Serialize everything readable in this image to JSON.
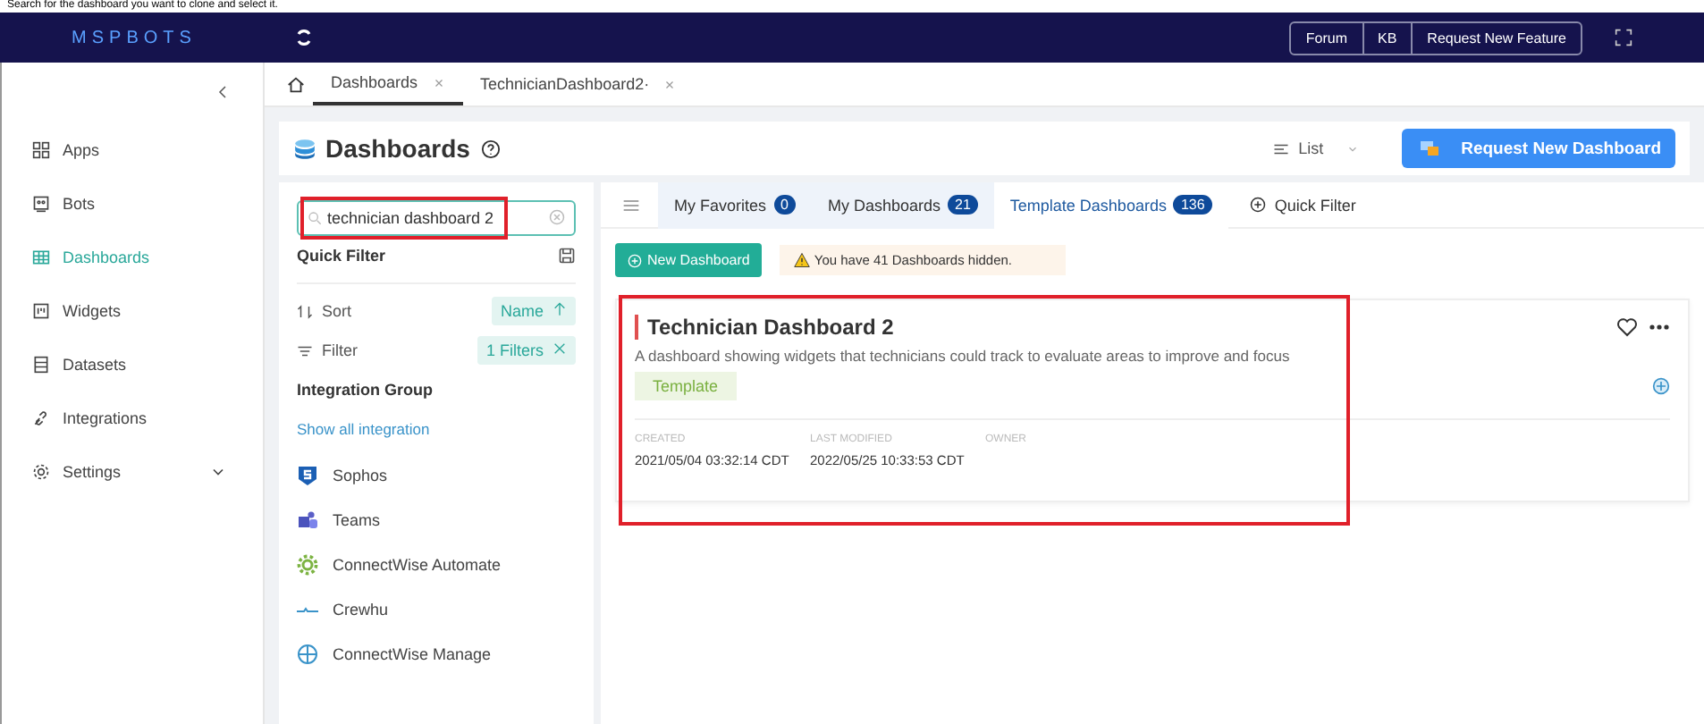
{
  "caption": "Search for the dashboard you want to clone and select it.",
  "topbar": {
    "logo": "MSPBOTS",
    "links": [
      "Forum",
      "KB",
      "Request New Feature"
    ]
  },
  "sidebar": {
    "items": [
      {
        "label": "Apps",
        "selected": false
      },
      {
        "label": "Bots",
        "selected": false
      },
      {
        "label": "Dashboards",
        "selected": true
      },
      {
        "label": "Widgets",
        "selected": false
      },
      {
        "label": "Datasets",
        "selected": false
      },
      {
        "label": "Integrations",
        "selected": false
      },
      {
        "label": "Settings",
        "selected": false,
        "expandable": true
      }
    ]
  },
  "page_tabs": [
    {
      "label": "Dashboards",
      "selected": true
    },
    {
      "label": "TechnicianDashboard2·",
      "selected": false
    }
  ],
  "header": {
    "title": "Dashboards",
    "view": "List",
    "action": "Request New Dashboard"
  },
  "filter_panel": {
    "search": {
      "value": "technician dashboard 2",
      "highlighted": true
    },
    "quick_filter": "Quick Filter",
    "sort": {
      "label": "Sort",
      "value": "Name"
    },
    "filter": {
      "label": "Filter",
      "value": "1 Filters"
    },
    "group_title": "Integration Group",
    "show_all": "Show all integration",
    "integrations": [
      {
        "name": "Sophos"
      },
      {
        "name": "Teams"
      },
      {
        "name": "ConnectWise Automate"
      },
      {
        "name": "Crewhu"
      },
      {
        "name": "ConnectWise Manage"
      }
    ]
  },
  "tabs": [
    {
      "label": "My Favorites",
      "count": "0",
      "selected": false
    },
    {
      "label": "My Dashboards",
      "count": "21",
      "selected": false
    },
    {
      "label": "Template Dashboards",
      "count": "136",
      "selected": true
    }
  ],
  "quick_filter": "Quick Filter",
  "new_button": "New Dashboard",
  "notice": "You have 41 Dashboards hidden.",
  "card": {
    "title": "Technician Dashboard 2",
    "description": "A dashboard showing widgets that technicians could track to evaluate areas to improve and focus",
    "tag": "Template",
    "highlighted": true,
    "meta": [
      {
        "label": "CREATED",
        "value": "2021/05/04 03:32:14 CDT"
      },
      {
        "label": "LAST MODIFIED",
        "value": "2022/05/25 10:33:53 CDT"
      },
      {
        "label": "OWNER"
      }
    ]
  }
}
